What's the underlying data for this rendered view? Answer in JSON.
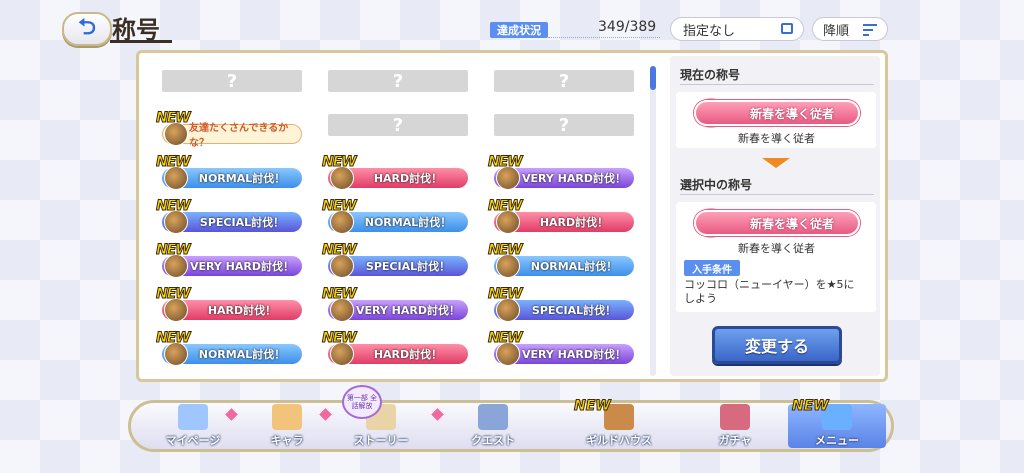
{
  "header": {
    "back_icon": "back-arrow-icon",
    "title": "称号",
    "achievement_label": "達成状況",
    "achievement_count": "349/389",
    "filter_label": "指定なし",
    "sort_label": "降順"
  },
  "grid": {
    "unknown_mark": "?",
    "new_label": "NEW",
    "cells": [
      {
        "type": "unknown"
      },
      {
        "type": "unknown"
      },
      {
        "type": "unknown"
      },
      {
        "type": "friend",
        "new": true,
        "label": "友達たくさんできるかな？"
      },
      {
        "type": "unknown"
      },
      {
        "type": "unknown"
      },
      {
        "type": "normal",
        "new": true,
        "label": "NORMAL討伐！"
      },
      {
        "type": "hard",
        "new": true,
        "label": "HARD討伐！"
      },
      {
        "type": "veryhard",
        "new": true,
        "label": "VERY HARD討伐！"
      },
      {
        "type": "special",
        "new": true,
        "label": "SPECIAL討伐！"
      },
      {
        "type": "normal",
        "new": true,
        "label": "NORMAL討伐！"
      },
      {
        "type": "hard",
        "new": true,
        "label": "HARD討伐！"
      },
      {
        "type": "veryhard",
        "new": true,
        "label": "VERY HARD討伐！"
      },
      {
        "type": "special",
        "new": true,
        "label": "SPECIAL討伐！"
      },
      {
        "type": "normal",
        "new": true,
        "label": "NORMAL討伐！"
      },
      {
        "type": "hard",
        "new": true,
        "label": "HARD討伐！"
      },
      {
        "type": "veryhard",
        "new": true,
        "label": "VERY HARD討伐！"
      },
      {
        "type": "special",
        "new": true,
        "label": "SPECIAL討伐！"
      },
      {
        "type": "normal",
        "new": true,
        "label": "NORMAL討伐！"
      },
      {
        "type": "hard",
        "new": true,
        "label": "HARD討伐！"
      },
      {
        "type": "veryhard",
        "new": true,
        "label": "VERY HARD討伐！"
      }
    ]
  },
  "side": {
    "current_heading": "現在の称号",
    "current_banner": "新春を導く従者",
    "current_name": "新春を導く従者",
    "selected_heading": "選択中の称号",
    "selected_banner": "新春を導く従者",
    "selected_name": "新春を導く従者",
    "condition_label": "入手条件",
    "condition_text": "コッコロ（ニューイヤー）を★5にしよう",
    "change_button": "変更する"
  },
  "nav": {
    "items": [
      {
        "label": "マイページ",
        "icon": "castle-icon",
        "new": false,
        "active": false
      },
      {
        "label": "キャラ",
        "icon": "character-icon",
        "new": false,
        "active": false
      },
      {
        "label": "ストーリー",
        "icon": "scroll-icon",
        "new": false,
        "active": false
      },
      {
        "label": "クエスト",
        "icon": "sword-shield-icon",
        "new": false,
        "active": false
      },
      {
        "label": "ギルドハウス",
        "icon": "door-icon",
        "new": true,
        "active": false
      },
      {
        "label": "ガチャ",
        "icon": "gacha-icon",
        "new": false,
        "active": false
      },
      {
        "label": "メニュー",
        "icon": "crystal-icon",
        "new": true,
        "active": true
      }
    ],
    "story_badge": "第一部 全話解放"
  },
  "colors": {
    "accent_blue": "#3a66c8",
    "normal": "#3c8fe8",
    "hard": "#e03c66",
    "veryhard": "#7a45d8",
    "special": "#5a55d8"
  }
}
